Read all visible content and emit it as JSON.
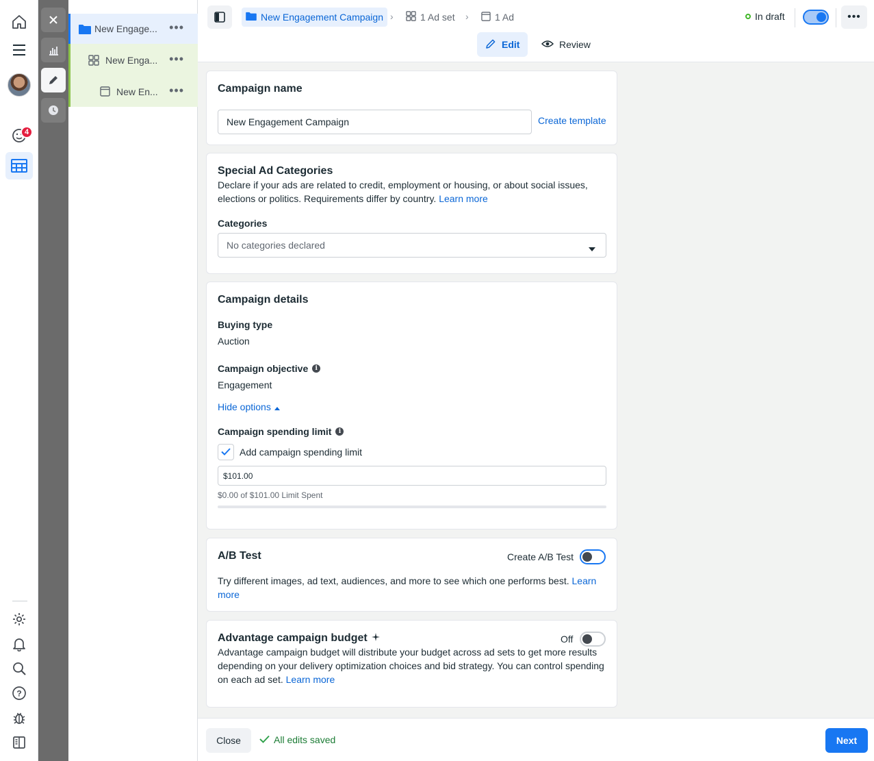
{
  "rail": {
    "notifications_count": "4",
    "icons": [
      "home-icon",
      "menu-icon",
      "avatar",
      "notifications-icon",
      "ads-manager-icon",
      "settings-icon",
      "bell-icon",
      "search-icon",
      "help-icon",
      "bug-icon",
      "panel-toggle-icon"
    ]
  },
  "toolstrip": {
    "icons": [
      "close-icon",
      "chart-icon",
      "edit-pencil-icon",
      "history-clock-icon"
    ]
  },
  "tree": {
    "items": [
      {
        "label": "New Engage...",
        "icon": "folder-icon"
      },
      {
        "label": "New Enga...",
        "icon": "grid-icon"
      },
      {
        "label": "New En...",
        "icon": "ad-icon"
      }
    ],
    "more": "•••"
  },
  "header": {
    "breadcrumbs": [
      {
        "label": "New Engagement Campaign",
        "icon": "folder-icon"
      },
      {
        "label": "1 Ad set",
        "icon": "grid-icon"
      },
      {
        "label": "1 Ad",
        "icon": "ad-icon"
      }
    ],
    "separator": "›",
    "status": "In draft",
    "more": "•••",
    "tabs": [
      {
        "label": "Edit",
        "icon": "pencil-icon"
      },
      {
        "label": "Review",
        "icon": "eye-icon"
      }
    ]
  },
  "campaign_name": {
    "title": "Campaign name",
    "value": "New Engagement Campaign",
    "create_template": "Create template"
  },
  "special": {
    "title": "Special Ad Categories",
    "description": "Declare if your ads are related to credit, employment or housing, or about social issues, elections or politics. Requirements differ by country.",
    "learn_more": "Learn more",
    "categories_label": "Categories",
    "categories_value": "No categories declared"
  },
  "details": {
    "title": "Campaign details",
    "buying_type_label": "Buying type",
    "buying_type_value": "Auction",
    "objective_label": "Campaign objective",
    "objective_value": "Engagement",
    "hide_options": "Hide options",
    "spending_limit_label": "Campaign spending limit",
    "spending_checkbox_label": "Add campaign spending limit",
    "spending_checked": true,
    "spending_value": "$101.00",
    "spent_text": "$0.00 of $101.00 Limit Spent",
    "spent_fraction": 0
  },
  "ab_test": {
    "title": "A/B Test",
    "toggle_label": "Create A/B Test",
    "description": "Try different images, ad text, audiences, and more to see which one performs best.",
    "learn_more": "Learn more"
  },
  "advantage": {
    "title": "Advantage campaign budget",
    "toggle_label": "Off",
    "description": "Advantage campaign budget will distribute your budget across ad sets to get more results depending on your delivery optimization choices and bid strategy. You can control spending on each ad set.",
    "learn_more": "Learn more"
  },
  "footer": {
    "close": "Close",
    "saved": "All edits saved",
    "next": "Next"
  },
  "colors": {
    "accent": "#1877f2",
    "link": "#0a66d6",
    "draft_green": "#42b72a",
    "badge_red": "#e41e3f"
  }
}
